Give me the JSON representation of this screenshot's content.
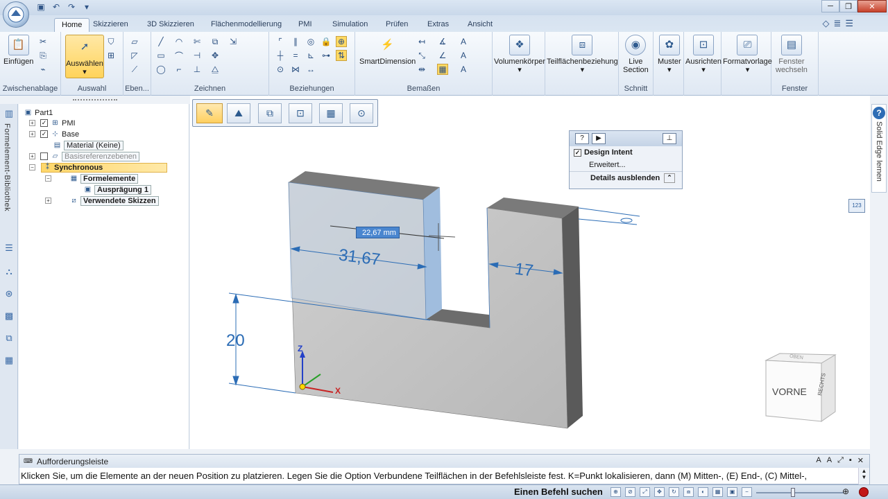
{
  "quick_access": [
    "save-icon",
    "undo-icon",
    "redo-icon",
    "dropdown-icon"
  ],
  "window_controls": [
    "minimize",
    "maximize",
    "close"
  ],
  "tabs": [
    {
      "label": "Home",
      "active": true
    },
    {
      "label": "Skizzieren"
    },
    {
      "label": "3D Skizzieren"
    },
    {
      "label": "Flächenmodellierung"
    },
    {
      "label": "PMI"
    },
    {
      "label": "Simulation"
    },
    {
      "label": "Prüfen"
    },
    {
      "label": "Extras"
    },
    {
      "label": "Ansicht"
    }
  ],
  "ribbon": {
    "clipboard": {
      "label": "Zwischenablage",
      "paste": "Einfügen"
    },
    "selection": {
      "label": "Auswahl",
      "select": "Auswählen"
    },
    "planes": {
      "label": "Eben..."
    },
    "draw": {
      "label": "Zeichnen"
    },
    "relations": {
      "label": "Beziehungen"
    },
    "dimensions": {
      "label": "Bemaßen",
      "smart": "SmartDimension"
    },
    "solids": {
      "label": "Volumenkörper"
    },
    "face_rel": {
      "label": "Teilflächenbeziehung"
    },
    "section": {
      "label": "Schnitt",
      "live1": "Live",
      "live2": "Section"
    },
    "pattern": {
      "label": "Muster"
    },
    "align": {
      "label": "Ausrichten"
    },
    "format": {
      "label": "Formatvorlage"
    },
    "window": {
      "label": "Fenster",
      "switch1": "Fenster",
      "switch2": "wechseln"
    }
  },
  "left_dock": {
    "library_label": "Formelement-Bibliothek"
  },
  "tree": {
    "part": "Part1",
    "pmi": "PMI",
    "base": "Base",
    "material": "Material (Keine)",
    "ref_planes": "Basisreferenzebenen",
    "synchronous": "Synchronous",
    "features": "Formelemente",
    "protrusion": "Ausprägung 1",
    "used_sketches": "Verwendete Skizzen"
  },
  "design_intent": {
    "title": "Design Intent",
    "advanced": "Erweitert...",
    "hide_details": "Details ausblenden"
  },
  "model": {
    "dim_width": "31,67",
    "dim_right": "17",
    "dim_height": "20",
    "input_value": "22,67 mm",
    "axis_x": "X",
    "axis_z": "Z"
  },
  "view_cube": {
    "front": "VORNE",
    "right": "RECHTS",
    "top": "OBEN"
  },
  "help_panel": {
    "label": "Solid Edge lernen"
  },
  "prompt": {
    "title": "Aufforderungsleiste",
    "text": "Klicken Sie, um die Elemente an der neuen Position zu platzieren. Legen Sie die Option Verbundene Teilflächen in der Befehlsleiste fest. K=Punkt lokalisieren, dann (M) Mitten-, (E) End-, (C) Mittel-,"
  },
  "status": {
    "find_command": "Einen Befehl suchen"
  },
  "colors": {
    "accent_yellow": "#ffd35a",
    "dim_blue": "#2b6cb5",
    "ribbon_bg": "#e6eef7"
  }
}
